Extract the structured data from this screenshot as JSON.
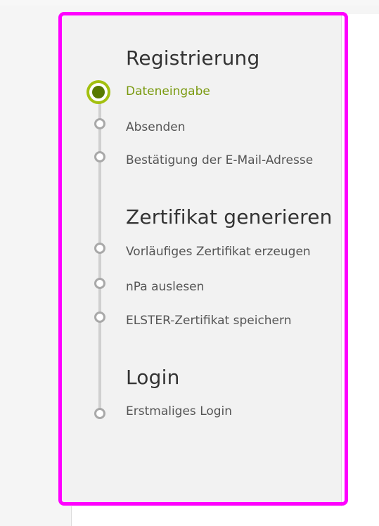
{
  "progress_sidebar": {
    "sections": [
      {
        "title": "Registrierung",
        "steps": [
          "Dateneingabe",
          "Absenden",
          "Bestätigung der E-Mail-Adresse"
        ]
      },
      {
        "title": "Zertifikat generieren",
        "steps": [
          "Vorläufiges Zertifikat erzeugen",
          "nPa auslesen",
          "ELSTER-Zertifikat speichern"
        ]
      },
      {
        "title": "Login",
        "steps": [
          "Erstmaliges Login"
        ]
      }
    ],
    "active_step": "Dateneingabe",
    "colors": {
      "highlight_border": "#ff00ff",
      "active_step_text": "#7a9a10",
      "active_dot_ring": "#a3c00f",
      "active_dot_center": "#587a00",
      "inactive_dot": "#a9a9a9"
    }
  }
}
